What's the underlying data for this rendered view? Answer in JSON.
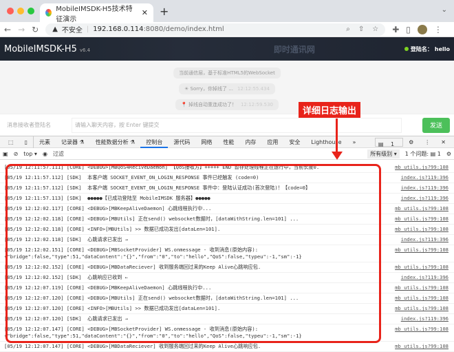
{
  "browser": {
    "tab_title": "MobileIMSDK-H5技术特征演示",
    "insecure": "不安全",
    "host": "192.168.0.114",
    "path": ":8080/demo/index.html"
  },
  "app": {
    "title": "MobileIMSDK-H5",
    "version": "v6.4",
    "brand": "即时通讯网",
    "login_label": "登陆名：",
    "login_user": "hello"
  },
  "chat": {
    "messages": [
      {
        "text": "当前通信层，基于标准HTML5的WebSocket",
        "time": ""
      },
      {
        "text": "☀ Sorry，你掉线了 ...",
        "time": "12:12:55.434"
      },
      {
        "text": "📍 掉线自动重连成功了！",
        "time": "12:12:59.530"
      }
    ],
    "receiver_placeholder": "消息接收者登陆名",
    "input_placeholder": "请输入聊天内容，按 Enter 键提交",
    "send_label": "发送"
  },
  "devtools": {
    "tabs": [
      "元素",
      "记录器 ⚗",
      "性能数据分析 ⚗",
      "控制台",
      "源代码",
      "网络",
      "性能",
      "内存",
      "应用",
      "安全",
      "Lighthouse",
      "»"
    ],
    "active_tab": "控制台",
    "issues_badge": "1",
    "context": "top ▾",
    "filter_placeholder": "过滤",
    "levels": "所有级别 ▾",
    "issues": "1 个问题: ",
    "issues_count": "1"
  },
  "annotation": "详细日志输出",
  "logs": [
    {
      "m": "[05/19 12:11:57.111] [CORE] <DEBUG>[MBQoS4ReciveDaemon] 【QoS接收方】+++++ END 暂存处理线程正在运行中，当前长度0.",
      "s": "mb_utils.js?99:108"
    },
    {
      "m": "[05/19 12:11:57.112] [SDK]  本客户端 SOCKET_EVENT_ON_LOGIN_RESPONSE 事件已经触发 (code=0)",
      "s": "index.js?119:396"
    },
    {
      "m": "[05/19 12:11:57.112] [SDK]  本客户端 SOCKET_EVENT_ON_LOGIN_RESPONSE 事件中：登陆认证成功(首次登陆)！【code=0】",
      "s": "index.js?119:396"
    },
    {
      "m": "[05/19 12:11:57.113] [SDK]  ●●●●●【已成功登陆至 MobileIMSDK 服务器】●●●●●",
      "s": "index.js?119:396"
    },
    {
      "m": "[05/19 12:12:02.117] [CORE] <DEBUG>[MBKeepAliveDaemon] 心跳线程执行中...",
      "s": "mb_utils.js?99:108"
    },
    {
      "m": "[05/19 12:12:02.118] [CORE] <DEBUG>[MBUtils] 正在send() websocket数据时，[dataWithString.len=101] ...",
      "s": "mb_utils.js?99:108"
    },
    {
      "m": "[05/19 12:12:02.118] [CORE] <INFO>[MBUtils] >> 数据已成功发出[dataLen=101].",
      "s": "mb_utils.js?99:108"
    },
    {
      "m": "[05/19 12:12:02.118] [SDK]  心跳请求已发出 →",
      "s": "index.js?119:396"
    },
    {
      "m": "[05/19 12:12:02.151] [CORE] <DEBUG>[MBSocketProvider] WS.onmessage - 收到消息(原始内容):\n{\"bridge\":false,\"type\":51,\"dataContent\":\"{}\",\"from\":\"0\",\"to\":\"hello\",\"QoS\":false,\"typeu\":-1,\"sm\":-1}",
      "s": "mb_utils.js?99:108"
    },
    {
      "m": "[05/19 12:12:02.152] [CORE] <DEBUG>[MBDataReciever] 收到服务端回过来的Keep Alive心跳响应包.",
      "s": "mb_utils.js?99:108"
    },
    {
      "m": "[05/19 12:12:02.152] [SDK]  心跳响应已收到 ←",
      "s": "index.js?119:396"
    },
    {
      "m": "[05/19 12:12:07.119] [CORE] <DEBUG>[MBKeepAliveDaemon] 心跳线程执行中...",
      "s": "mb_utils.js?99:108"
    },
    {
      "m": "[05/19 12:12:07.120] [CORE] <DEBUG>[MBUtils] 正在send() websocket数据时，[dataWithString.len=101] ...",
      "s": "mb_utils.js?99:108"
    },
    {
      "m": "[05/19 12:12:07.120] [CORE] <INFO>[MBUtils] >> 数据已成功发出[dataLen=101].",
      "s": "mb_utils.js?99:108"
    },
    {
      "m": "[05/19 12:12:07.120] [SDK]  心跳请求已发出 →",
      "s": "index.js?119:396"
    },
    {
      "m": "[05/19 12:12:07.147] [CORE] <DEBUG>[MBSocketProvider] WS.onmessage - 收到消息(原始内容):\n{\"bridge\":false,\"type\":51,\"dataContent\":\"{}\",\"from\":\"0\",\"to\":\"hello\",\"QoS\":false,\"typeu\":-1,\"sm\":-1}",
      "s": "mb_utils.js?99:108"
    },
    {
      "m": "[05/19 12:12:07.147] [CORE] <DEBUG>[MBDataReciever] 收到服务端回过来的Keep Alive心跳响应包.",
      "s": "mb_utils.js?99:108"
    }
  ]
}
